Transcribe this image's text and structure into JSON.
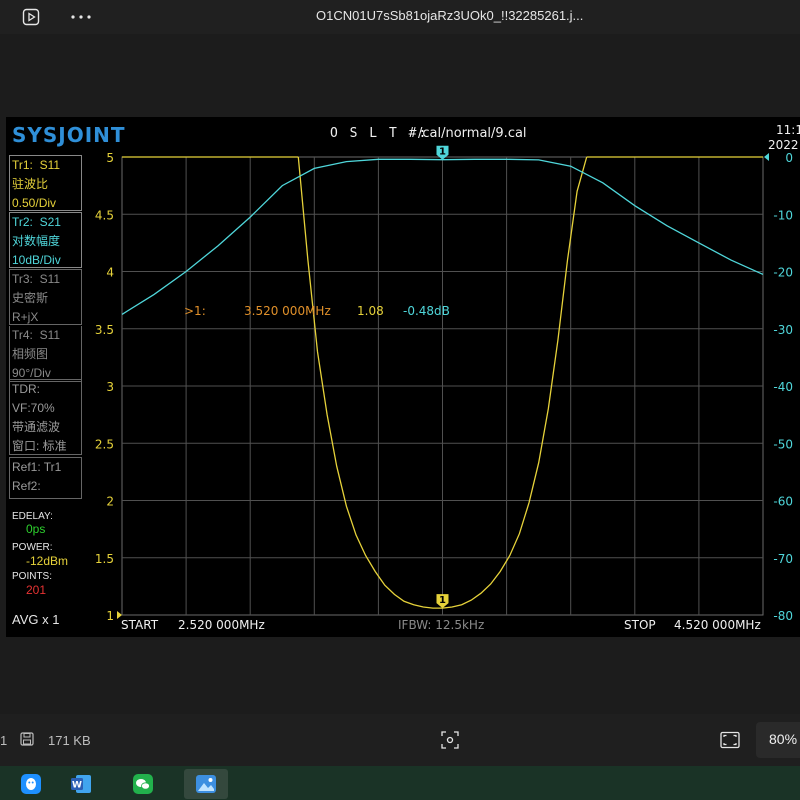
{
  "window": {
    "title": "O1CN01U7sSb81ojaRz3UOk0_!!32285261.j..."
  },
  "icons": {
    "slideshow": "play-square-icon",
    "more": "more-horizontal-icon",
    "disk": "save-icon",
    "fit": "fit-to-window-icon",
    "actual": "actual-size-icon"
  },
  "vna": {
    "brand": "SYSJOINT",
    "cal_label": "O S L T #:",
    "cal_file": "/cal/normal/9.cal",
    "clock_time": "11:1",
    "clock_date": "2022",
    "traces": [
      {
        "name": "Tr1:",
        "param": "S11",
        "format": "驻波比",
        "scale": "0.50/Div"
      },
      {
        "name": "Tr2:",
        "param": "S21",
        "format": "对数幅度",
        "scale": "10dB/Div"
      },
      {
        "name": "Tr3:",
        "param": "S11",
        "format": "史密斯",
        "scale": "R+jX"
      },
      {
        "name": "Tr4:",
        "param": "S11",
        "format": "相频图",
        "scale": "90°/Div"
      }
    ],
    "tdr": {
      "label": "TDR:",
      "vf": "VF:70%",
      "mode": "带通滤波",
      "window": "窗口: 标准"
    },
    "refs": {
      "ref1": "Ref1: Tr1",
      "ref2": "Ref2:"
    },
    "edelay_label": "EDELAY:",
    "edelay_value": "0ps",
    "power_label": "POWER:",
    "power_value": "-12dBm",
    "points_label": "POINTS:",
    "points_value": "201",
    "avg": "AVG x 1",
    "start_label": "START",
    "start_value": "2.520 000MHz",
    "ifbw": "IFBW: 12.5kHz",
    "stop_label": "STOP",
    "stop_value": "4.520 000MHz",
    "marker": {
      "id": "1",
      "prefix": ">1:",
      "freq": "3.520 000MHz",
      "swr": "1.08",
      "s21": "-0.48dB"
    },
    "colors": {
      "tr1": "#e6d23a",
      "tr2": "#4fd6da",
      "marker_freq": "#e0902a",
      "brand": "#2f8fd8",
      "edelay": "#2ed12e",
      "power": "#e6d23a",
      "points": "#e63232"
    }
  },
  "chart_data": {
    "type": "line",
    "title": "",
    "xlabel": "",
    "x_range_mhz": [
      2.52,
      4.52
    ],
    "y_left": {
      "label": "",
      "ticks": [
        "5",
        "4.5",
        "4",
        "3.5",
        "3",
        "2.5",
        "2",
        "1.5",
        "1"
      ],
      "range": [
        1,
        5
      ]
    },
    "y_right": {
      "label": "",
      "ticks": [
        "0",
        "-10",
        "-20",
        "-30",
        "-40",
        "-50",
        "-60",
        "-70",
        "-80"
      ],
      "range": [
        -80,
        0
      ]
    },
    "grid": true,
    "series": [
      {
        "axis": "left",
        "x": [
          3.07,
          3.1,
          3.13,
          3.16,
          3.19,
          3.22,
          3.25,
          3.28,
          3.31,
          3.34,
          3.37,
          3.4,
          3.43,
          3.46,
          3.49,
          3.52,
          3.55,
          3.58,
          3.61,
          3.64,
          3.67,
          3.7,
          3.73,
          3.76,
          3.79,
          3.82,
          3.85,
          3.88,
          3.91,
          3.94,
          3.97
        ],
        "y": [
          5.0,
          4.1,
          3.3,
          2.75,
          2.3,
          1.95,
          1.7,
          1.52,
          1.38,
          1.26,
          1.18,
          1.12,
          1.09,
          1.07,
          1.06,
          1.06,
          1.07,
          1.09,
          1.13,
          1.19,
          1.27,
          1.38,
          1.52,
          1.71,
          1.98,
          2.33,
          2.8,
          3.4,
          4.1,
          4.7,
          5.0
        ]
      },
      {
        "axis": "right",
        "x": [
          2.52,
          2.62,
          2.72,
          2.82,
          2.92,
          3.02,
          3.12,
          3.22,
          3.32,
          3.42,
          3.52,
          3.62,
          3.72,
          3.82,
          3.92,
          4.02,
          4.12,
          4.22,
          4.32,
          4.42,
          4.52
        ],
        "y": [
          -27.5,
          -24.0,
          -20.0,
          -15.5,
          -10.5,
          -5.0,
          -2.0,
          -0.8,
          -0.4,
          -0.4,
          -0.48,
          -0.4,
          -0.4,
          -0.5,
          -1.6,
          -4.5,
          -8.5,
          -12.0,
          -15.0,
          -18.0,
          -20.5
        ]
      }
    ]
  },
  "statusbar": {
    "page": "1",
    "size": "171 KB",
    "zoom": "80%"
  },
  "taskbar": {
    "apps": [
      {
        "name": "qq-app-icon",
        "color": "#1e90ff"
      },
      {
        "name": "word-app-icon",
        "color": "#2b5fb4"
      },
      {
        "name": "wechat-app-icon",
        "color": "#22b14c"
      },
      {
        "name": "photos-app-icon",
        "color": "#3d8fe0"
      }
    ]
  }
}
